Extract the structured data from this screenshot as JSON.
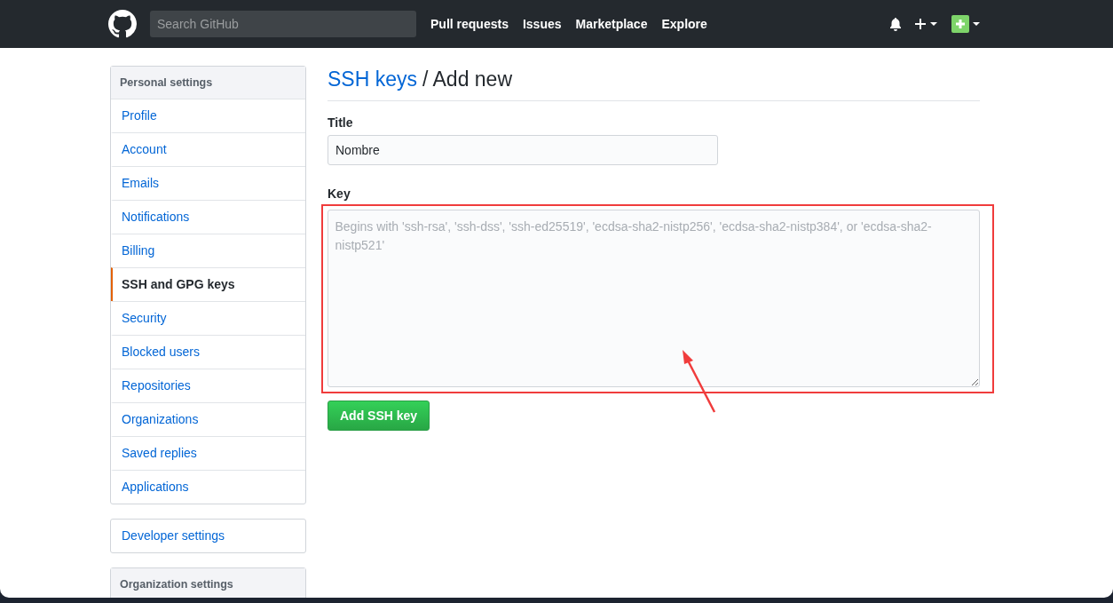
{
  "header": {
    "search": {
      "placeholder": "Search GitHub"
    },
    "nav": [
      "Pull requests",
      "Issues",
      "Marketplace",
      "Explore"
    ]
  },
  "sidebar": {
    "title": "Personal settings",
    "items": [
      {
        "label": "Profile",
        "selected": false
      },
      {
        "label": "Account",
        "selected": false
      },
      {
        "label": "Emails",
        "selected": false
      },
      {
        "label": "Notifications",
        "selected": false
      },
      {
        "label": "Billing",
        "selected": false
      },
      {
        "label": "SSH and GPG keys",
        "selected": true
      },
      {
        "label": "Security",
        "selected": false
      },
      {
        "label": "Blocked users",
        "selected": false
      },
      {
        "label": "Repositories",
        "selected": false
      },
      {
        "label": "Organizations",
        "selected": false
      },
      {
        "label": "Saved replies",
        "selected": false
      },
      {
        "label": "Applications",
        "selected": false
      }
    ]
  },
  "developer_settings": "Developer settings",
  "organization_settings": {
    "title": "Organization settings"
  },
  "heading": {
    "link": "SSH keys",
    "rest": "/ Add new"
  },
  "form": {
    "title_label": "Title",
    "title_value": "Nombre",
    "key_label": "Key",
    "key_placeholder": "Begins with 'ssh-rsa', 'ssh-dss', 'ssh-ed25519', 'ecdsa-sha2-nistp256', 'ecdsa-sha2-nistp384', or 'ecdsa-sha2-nistp521'",
    "submit": "Add SSH key"
  }
}
